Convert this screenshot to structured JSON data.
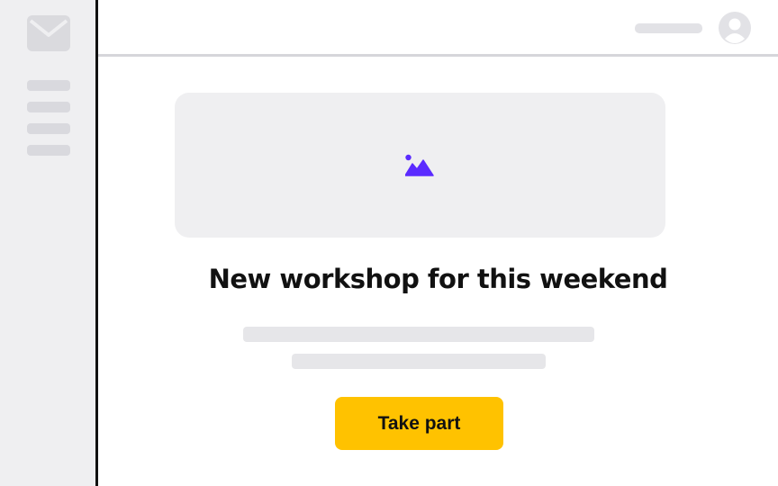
{
  "sidebar": {
    "icon": "mail-icon",
    "menu_placeholder_count": 4
  },
  "header": {
    "avatar_icon": "user-avatar-icon"
  },
  "main": {
    "hero_icon": "image-icon",
    "headline": "New workshop for this weekend",
    "cta_label": "Take part"
  },
  "colors": {
    "accent": "#ffc200",
    "icon_accent": "#5b2bff",
    "placeholder": "#e6e6e9",
    "panel": "#efeff1",
    "sidebar_border": "#111111"
  }
}
